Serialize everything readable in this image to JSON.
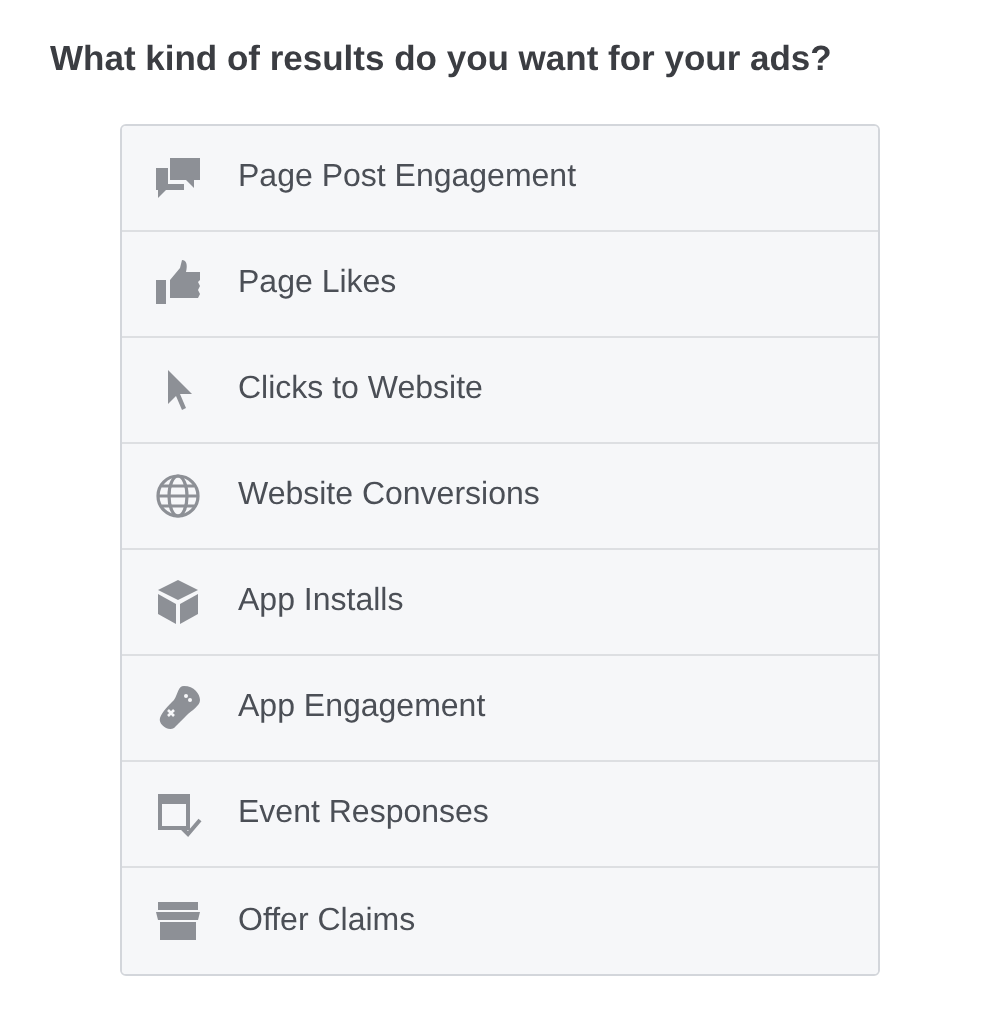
{
  "heading": "What kind of results do you want for your ads?",
  "options": [
    {
      "kind": "engagement",
      "label": "Page Post Engagement"
    },
    {
      "kind": "likes",
      "label": "Page Likes"
    },
    {
      "kind": "clicks",
      "label": "Clicks to Website"
    },
    {
      "kind": "conversions",
      "label": "Website Conversions"
    },
    {
      "kind": "installs",
      "label": "App Installs"
    },
    {
      "kind": "app-engagement",
      "label": "App Engagement"
    },
    {
      "kind": "events",
      "label": "Event Responses"
    },
    {
      "kind": "offers",
      "label": "Offer Claims"
    }
  ]
}
